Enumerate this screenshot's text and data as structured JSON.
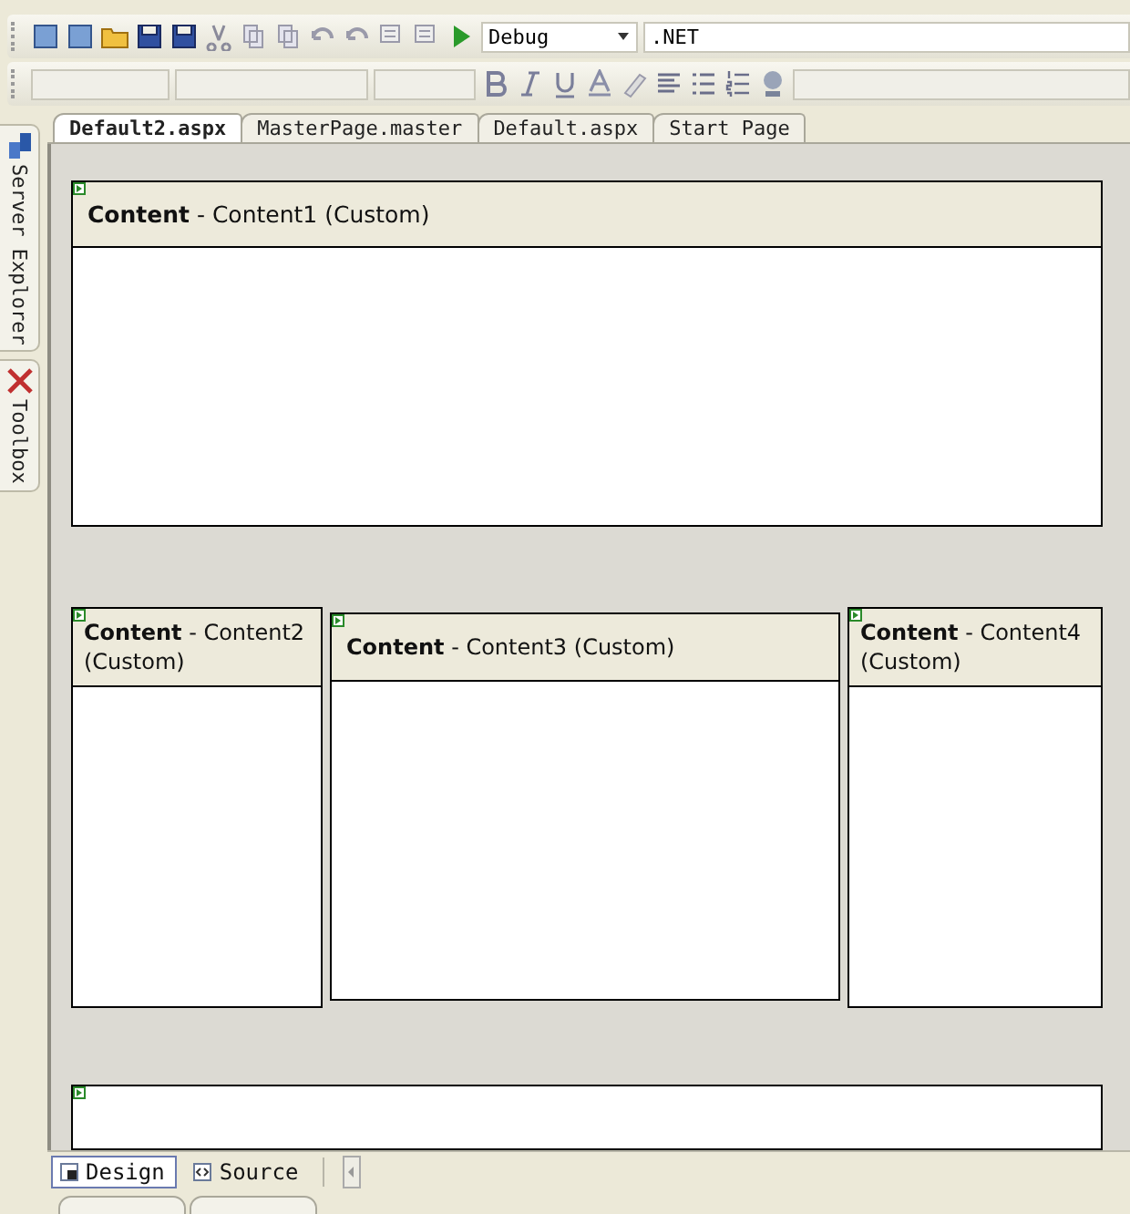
{
  "toolbar": {
    "configuration": "Debug",
    "platform": ".NET"
  },
  "side_tabs": [
    {
      "label": "Server Explorer"
    },
    {
      "label": "Toolbox"
    }
  ],
  "doc_tabs": [
    {
      "label": "Default2.aspx",
      "selected": true
    },
    {
      "label": "MasterPage.master",
      "selected": false
    },
    {
      "label": "Default.aspx",
      "selected": false
    },
    {
      "label": "Start Page",
      "selected": false
    }
  ],
  "main_region": {
    "header": "**Content** - Content1 (Custom)"
  },
  "row_regions": [
    {
      "header": "**Content** - Content2 (Custom)"
    },
    {
      "header": "**Content** - Content3 (Custom)"
    },
    {
      "header": "**Content** - Content4 (Custom)"
    }
  ],
  "view_tabs": [
    {
      "label": "Design",
      "selected": true
    },
    {
      "label": "Source",
      "selected": false
    }
  ]
}
